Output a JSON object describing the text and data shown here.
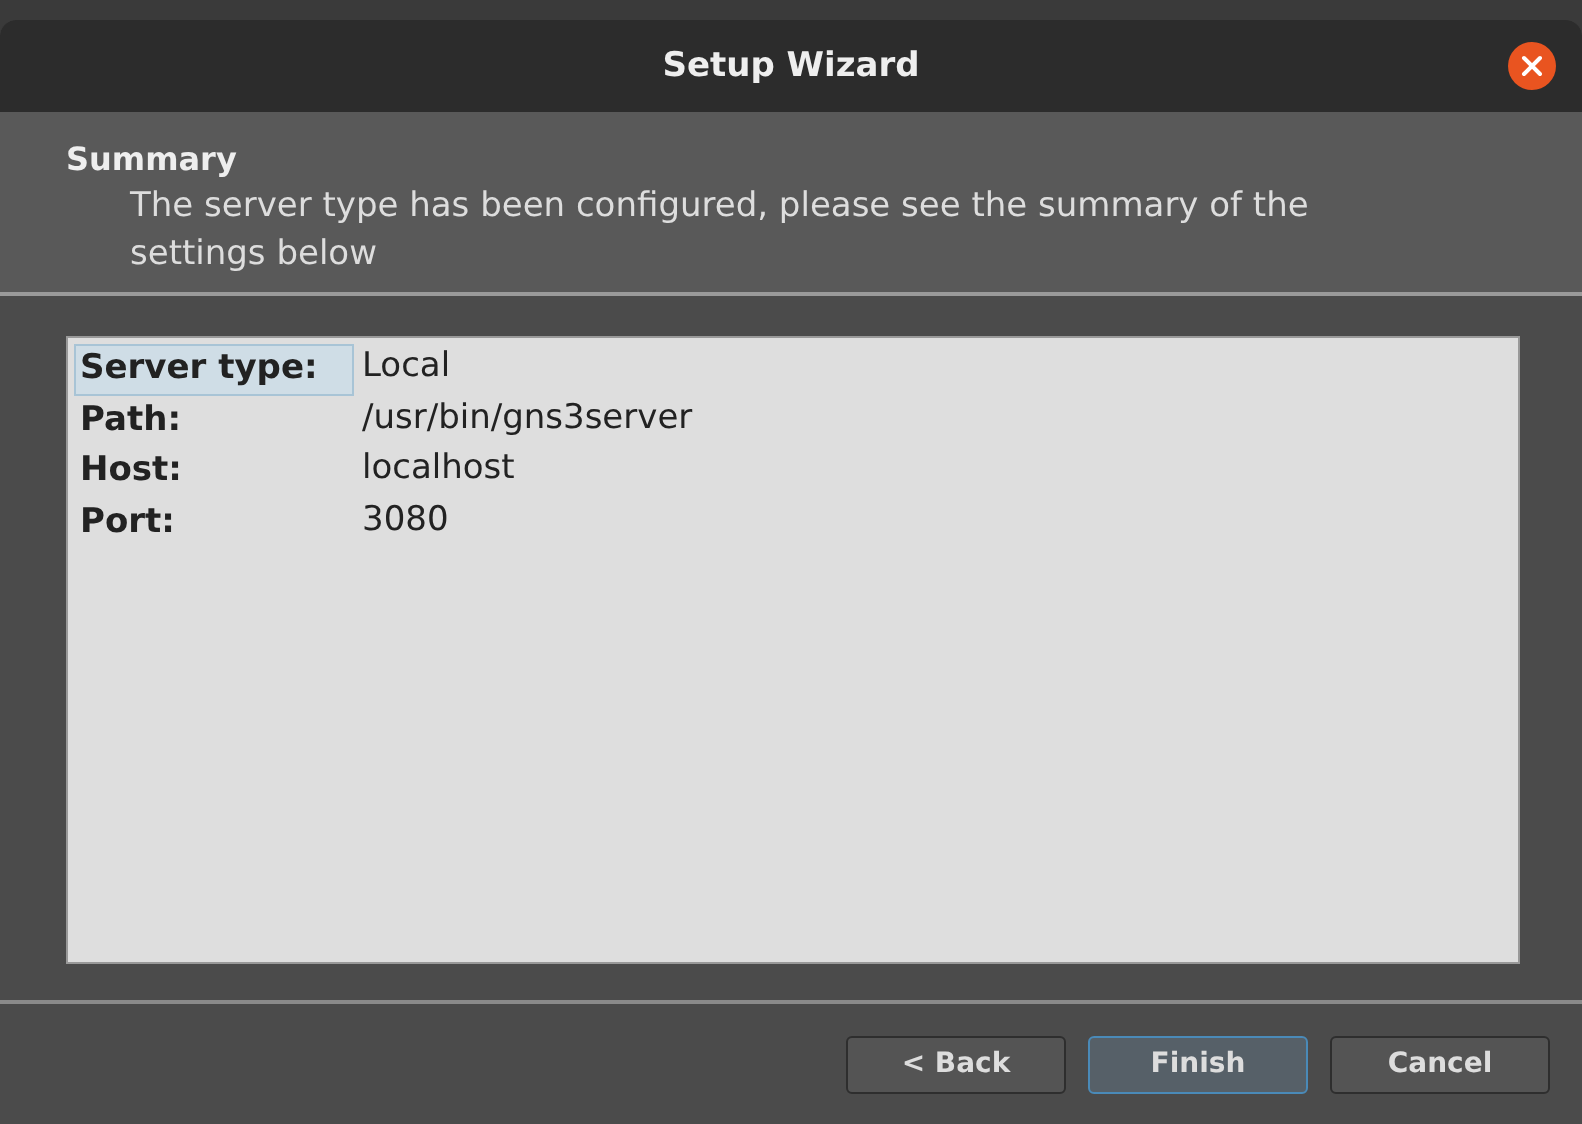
{
  "window": {
    "title": "Setup Wizard"
  },
  "header": {
    "title": "Summary",
    "subtitle": "The server type has been configured, please see the summary of the settings below"
  },
  "summary": [
    {
      "label": "Server type:",
      "value": "Local",
      "selected": true
    },
    {
      "label": "Path:",
      "value": "/usr/bin/gns3server",
      "selected": false
    },
    {
      "label": "Host:",
      "value": "localhost",
      "selected": false
    },
    {
      "label": "Port:",
      "value": "3080",
      "selected": false
    }
  ],
  "buttons": [
    {
      "label": "< Back",
      "default": false
    },
    {
      "label": "Finish",
      "default": true
    },
    {
      "label": "Cancel",
      "default": false
    }
  ]
}
